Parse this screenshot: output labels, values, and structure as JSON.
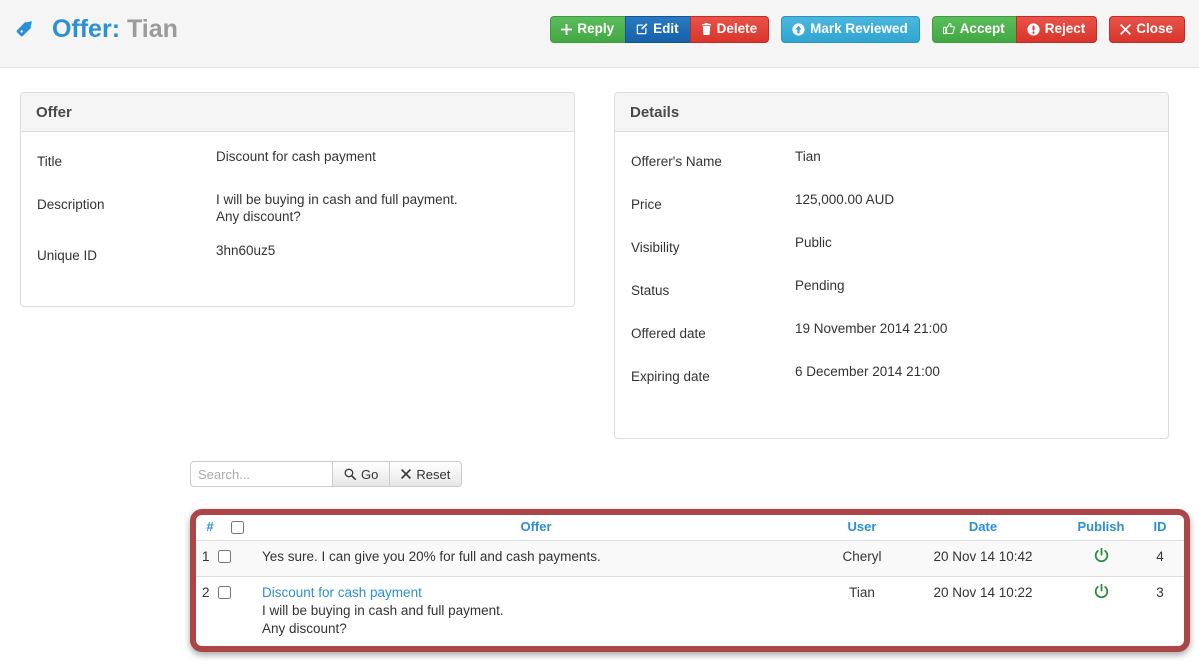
{
  "header": {
    "tag_icon": "tag-icon",
    "title_main": "Offer",
    "title_separator": ":",
    "title_sub": "Tian",
    "buttons": [
      {
        "label": "Reply",
        "icon": "plus-icon",
        "style": "green"
      },
      {
        "label": "Edit",
        "icon": "pencil-square-icon",
        "style": "blue"
      },
      {
        "label": "Delete",
        "icon": "trash-icon",
        "style": "red"
      },
      {
        "label": "Mark Reviewed",
        "icon": "arrow-up-circle-icon",
        "style": "cyan"
      },
      {
        "label": "Accept",
        "icon": "thumbs-up-icon",
        "style": "green"
      },
      {
        "label": "Reject",
        "icon": "exclamation-circle-icon",
        "style": "red"
      },
      {
        "label": "Close",
        "icon": "x-icon",
        "style": "red"
      }
    ]
  },
  "offer_panel": {
    "heading": "Offer",
    "rows": [
      {
        "term": "Title",
        "value": "Discount for cash payment"
      },
      {
        "term": "Description",
        "value": "I will be buying in cash and full payment.\nAny discount?"
      },
      {
        "term": "Unique ID",
        "value": "3hn60uz5"
      }
    ]
  },
  "details_panel": {
    "heading": "Details",
    "rows": [
      {
        "term": "Offerer's Name",
        "value": "Tian"
      },
      {
        "term": "Price",
        "value": "125,000.00 AUD"
      },
      {
        "term": "Visibility",
        "value": "Public"
      },
      {
        "term": "Status",
        "value": "Pending"
      },
      {
        "term": "Offered date",
        "value": "19 November 2014 21:00"
      },
      {
        "term": "Expiring date",
        "value": "6 December 2014 21:00"
      }
    ]
  },
  "search": {
    "placeholder": "Search...",
    "go_label": "Go",
    "go_icon": "search-icon",
    "reset_label": "Reset",
    "reset_icon": "x-icon"
  },
  "table": {
    "headers": {
      "num": "#",
      "select_all": "",
      "offer": "Offer",
      "user": "User",
      "date": "Date",
      "publish": "Publish",
      "id": "ID"
    },
    "rows": [
      {
        "num": "1",
        "title": "",
        "body": "Yes sure. I can give you 20% for full and cash payments.",
        "user": "Cheryl",
        "date": "20 Nov 14 10:42",
        "publish_icon": "power-icon",
        "id": "4"
      },
      {
        "num": "2",
        "title": "Discount for cash payment",
        "body": "I will be buying in cash and full payment.\nAny discount?",
        "user": "Tian",
        "date": "20 Nov 14 10:22",
        "publish_icon": "power-icon",
        "id": "3"
      }
    ]
  },
  "colors": {
    "accent_blue": "#2a8fd4",
    "green": "#43a843",
    "blue": "#1661a8",
    "red": "#d9352b",
    "cyan": "#2fa5d0",
    "highlight_border": "#ab4548",
    "power_green": "#2e8b3d",
    "muted_text": "#9b9b9b"
  }
}
